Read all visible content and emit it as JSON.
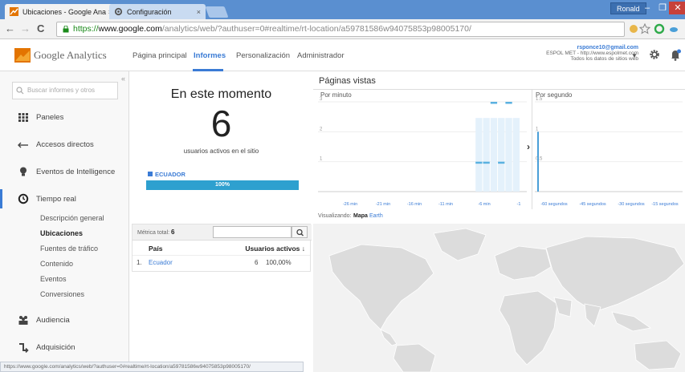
{
  "browser": {
    "tabs": [
      {
        "title": "Ubicaciones - Google Ana",
        "close": "×"
      },
      {
        "title": "Configuración",
        "close": "×"
      }
    ],
    "user": "Ronald",
    "window_controls": {
      "minimize": "–",
      "maximize": "❐",
      "close": "✕"
    },
    "nav": {
      "back": "←",
      "forward": "→",
      "reload": "C"
    },
    "url_scheme": "https://",
    "url_host": "www.google.com",
    "url_path": "/analytics/web/?authuser=0#realtime/rt-location/a59781586w94075853p98005170/",
    "status_url": "https://www.google.com/analytics/web/?authuser=0#realtime/rt-location/a59781586w94075853p98005170/"
  },
  "header": {
    "brand_google": "Google",
    "brand_analytics": "Analytics",
    "nav": [
      "Página principal",
      "Informes",
      "Personalización",
      "Administrador"
    ],
    "active_nav": "Informes",
    "account_email": "rsponce10@gmail.com",
    "account_site": "ESPOL MET - http://www.espolmet.com",
    "account_view": "Todos los datos de sitios web",
    "caret": "▼"
  },
  "sidebar": {
    "search_placeholder": "Buscar informes y otros",
    "collapse": "«",
    "items": [
      {
        "label": "Paneles"
      },
      {
        "label": "Accesos directos"
      },
      {
        "label": "Eventos de Intelligence"
      },
      {
        "label": "Tiempo real"
      },
      {
        "label": "Audiencia"
      },
      {
        "label": "Adquisición"
      }
    ],
    "subitems": [
      "Descripción general",
      "Ubicaciones",
      "Fuentes de tráfico",
      "Contenido",
      "Eventos",
      "Conversiones"
    ],
    "active_subitem": "Ubicaciones"
  },
  "overview": {
    "title": "En este momento",
    "active_users": "6",
    "caption": "usuarios activos en el sitio",
    "legend": "ECUADOR",
    "bar_label": "100%",
    "bar_fraction": 1.0
  },
  "table": {
    "metric_label": "Métrica total:",
    "metric_total": "6",
    "filter_button_icon": "search-icon",
    "col_country": "País",
    "col_users": "Usuarios activos ↓",
    "rows": [
      {
        "index": "1.",
        "country": "Ecuador",
        "users": "6",
        "pct": "100,00%"
      }
    ]
  },
  "pageviews": {
    "title": "Páginas vistas",
    "per_minute_label": "Por minuto",
    "per_second_label": "Por segundo",
    "arrow": "›"
  },
  "map": {
    "viewing_label": "Visualizando:",
    "map_tab": "Mapa",
    "earth_tab": "Earth"
  },
  "chart_data": [
    {
      "type": "bar",
      "title": "Por minuto",
      "ylim": [
        0,
        3
      ],
      "yticks": [
        "3",
        "2",
        "1"
      ],
      "x": [
        "-26 min",
        "-21 min",
        "-16 min",
        "-11 min",
        "-6 min",
        "-1"
      ],
      "minutes_ago": [
        6,
        5,
        4,
        3,
        2,
        1
      ],
      "values": [
        1,
        1,
        3,
        1,
        3,
        0
      ],
      "grid": true,
      "color": "#5ab1e0"
    },
    {
      "type": "bar",
      "title": "Por segundo",
      "ylim": [
        0,
        1.5
      ],
      "yticks": [
        "1.5",
        "1",
        "0.5"
      ],
      "x": [
        "-60 segundos",
        "-45 segundos",
        "-30 segundos",
        "-15 segundos"
      ],
      "seconds_ago": [
        59
      ],
      "values": [
        1
      ],
      "grid": true,
      "color": "#4a9fd8"
    }
  ]
}
